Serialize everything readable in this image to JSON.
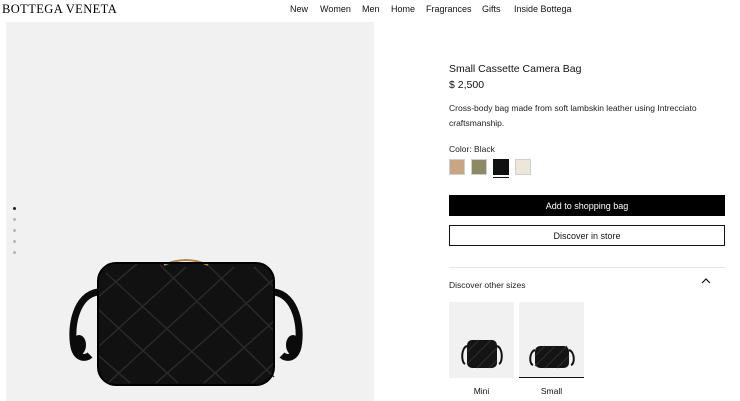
{
  "header": {
    "brand": "BOTTEGA VENETA",
    "nav": [
      "New",
      "Women",
      "Men",
      "Home",
      "Fragrances",
      "Gifts",
      "Inside Bottega"
    ]
  },
  "gallery": {
    "slides": 5,
    "active_slide": 1
  },
  "product": {
    "name": "Small Cassette Camera Bag",
    "price": "$ 2,500",
    "description": "Cross-body bag made from soft lambskin leather using Intrecciato craftsmanship.",
    "color_label": "Color: Black",
    "colors": [
      {
        "name": "tan",
        "hex": "#c9a683"
      },
      {
        "name": "olive",
        "hex": "#8c8a64"
      },
      {
        "name": "black",
        "hex": "#111111",
        "selected": true
      },
      {
        "name": "cream",
        "hex": "#ede6da"
      }
    ]
  },
  "actions": {
    "add_to_bag": "Add to shopping bag",
    "discover_store": "Discover in store"
  },
  "sizes": {
    "header": "Discover other sizes",
    "options": [
      {
        "label": "Mini",
        "selected": false
      },
      {
        "label": "Small",
        "selected": true
      }
    ]
  }
}
